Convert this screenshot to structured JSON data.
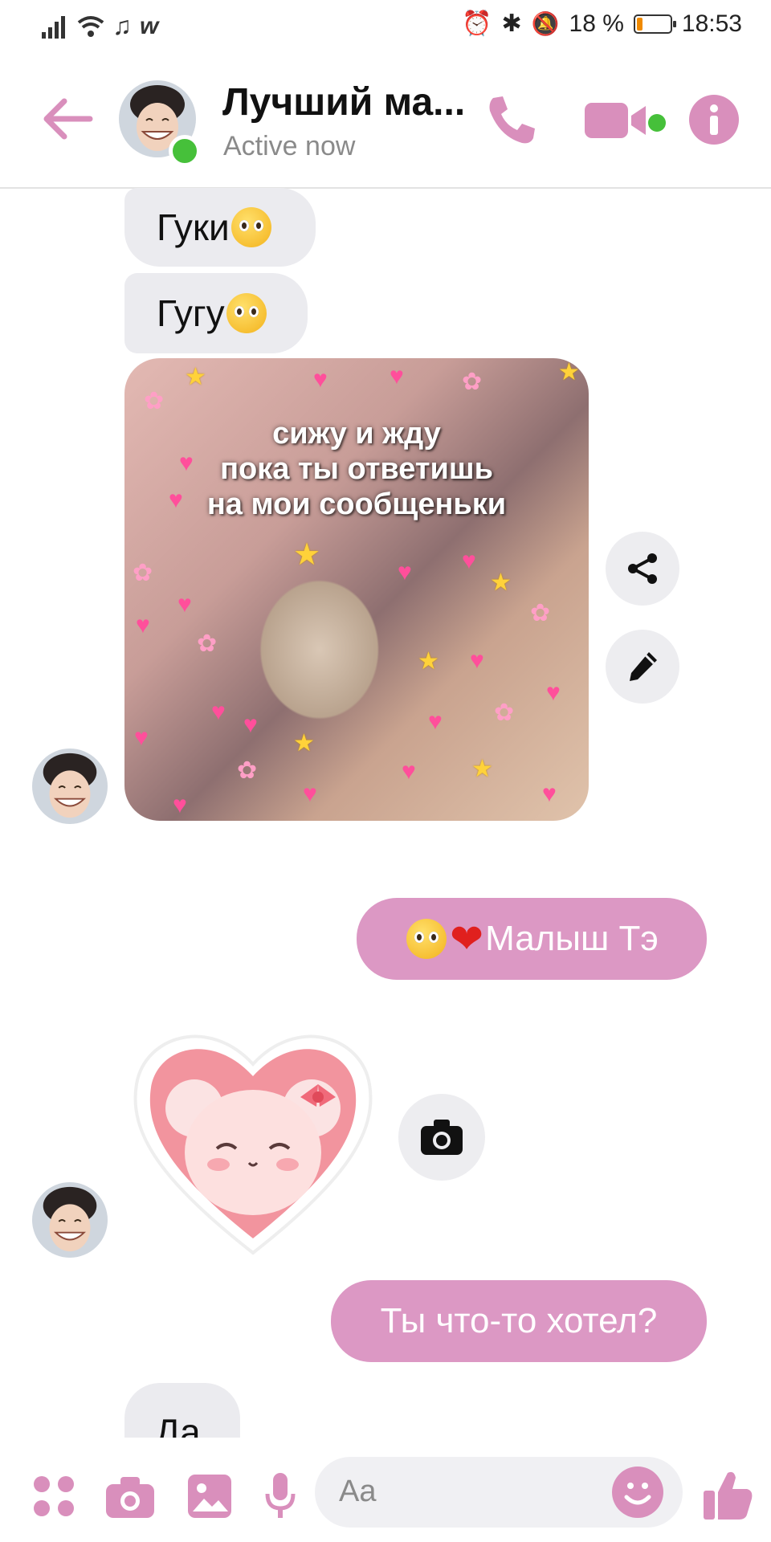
{
  "status_bar": {
    "battery_percent": "18 %",
    "battery_level": 0.18,
    "time": "18:53"
  },
  "header": {
    "contact_name": "Лучший ма...",
    "presence": "Active now"
  },
  "messages": [
    {
      "side": "in",
      "text": "Гуки",
      "emoji": "pleading-face"
    },
    {
      "side": "in",
      "text": "Гугу",
      "emoji": "pleading-face"
    },
    {
      "side": "in",
      "type": "image",
      "caption_lines": [
        "сижу и жду",
        "пока ты ответишь",
        "на мои сообщеньки"
      ]
    },
    {
      "side": "out",
      "text": "Малыш Тэ",
      "emoji": "pleading-face red-heart"
    },
    {
      "side": "in",
      "type": "sticker",
      "sticker": "pink heart bear sticker"
    },
    {
      "side": "out",
      "text": "Ты что-то хотел?"
    },
    {
      "side": "in",
      "text": "Да"
    }
  ],
  "composer": {
    "placeholder": "Aa"
  },
  "colors": {
    "accent": "#d98fbc",
    "outgoing_bubble": "#dc98c4",
    "incoming_bubble": "#ebebef",
    "online": "#46c03a"
  }
}
